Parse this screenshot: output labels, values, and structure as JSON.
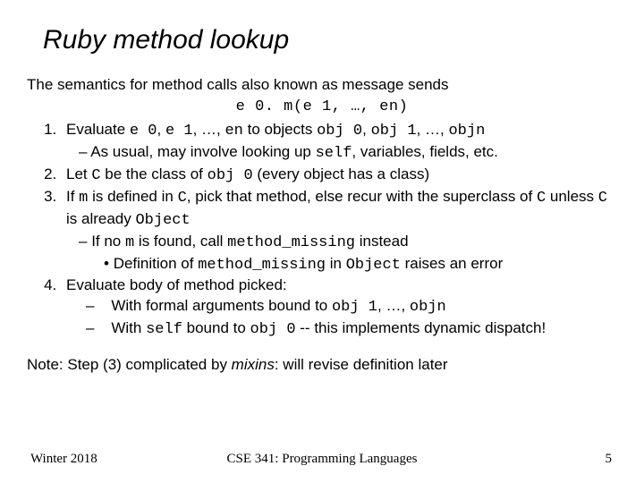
{
  "title": "Ruby method lookup",
  "intro": "The semantics for method calls also known as message sends",
  "codeCenter": "e 0. m(e 1, …, en)",
  "li1a": "Evaluate ",
  "li1b": "e 0",
  "li1c": ", ",
  "li1d": "e 1",
  "li1e": ", …, ",
  "li1f": "en",
  "li1g": " to objects ",
  "li1h": "obj 0",
  "li1i": ", ",
  "li1j": "obj 1",
  "li1k": ", …, ",
  "li1l": "objn",
  "li1sub_a": "As usual, may involve looking up ",
  "li1sub_b": "self",
  "li1sub_c": ", variables, fields, etc.",
  "li2a": "Let ",
  "li2b": "C",
  "li2c": " be the class of ",
  "li2d": "obj 0",
  "li2e": " (every object has a class)",
  "li3a": "If ",
  "li3b": "m",
  "li3c": " is defined in ",
  "li3d": "C",
  "li3e": ", pick that method, else recur with the superclass of ",
  "li3f": "C",
  "li3g": " unless ",
  "li3h": "C",
  "li3i": " is already ",
  "li3j": "Object",
  "li3sub_a": "If no ",
  "li3sub_b": "m",
  "li3sub_c": " is found, call ",
  "li3sub_d": "method_missing",
  "li3sub_e": " instead",
  "li3bullet_a": "Definition of ",
  "li3bullet_b": "method_missing",
  "li3bullet_c": " in ",
  "li3bullet_d": "Object",
  "li3bullet_e": " raises an error",
  "li4": "Evaluate body of method picked:",
  "li4sub1_a": "With formal arguments bound to ",
  "li4sub1_b": "obj 1",
  "li4sub1_c": ", …, ",
  "li4sub1_d": "objn",
  "li4sub2_a": "With ",
  "li4sub2_b": "self",
  "li4sub2_c": " bound to ",
  "li4sub2_d": "obj 0",
  "li4sub2_e": "  -- this implements dynamic dispatch!",
  "note_a": "Note: Step (3) complicated by ",
  "note_b": "mixins",
  "note_c": ": will revise definition later",
  "footer": {
    "left": "Winter 2018",
    "center": "CSE 341: Programming Languages",
    "right": "5"
  }
}
